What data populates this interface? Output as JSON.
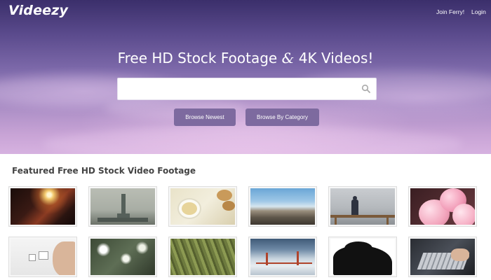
{
  "header": {
    "logo": "Videezy",
    "join_link": "Join Ferry!",
    "login_link": "Login"
  },
  "hero": {
    "headline_part1": "Free HD Stock Footage ",
    "headline_amp": "&",
    "headline_part2": " 4K Videos!",
    "search": {
      "value": "",
      "placeholder": ""
    },
    "buttons": {
      "browse_newest": "Browse Newest",
      "browse_category": "Browse By Category"
    }
  },
  "featured": {
    "title": "Featured Free HD Stock Video Footage",
    "rows": [
      [
        {
          "subject": "cave-light-beam"
        },
        {
          "subject": "statue-of-liberty"
        },
        {
          "subject": "tea-and-cookies"
        },
        {
          "subject": "rocky-beach"
        },
        {
          "subject": "person-at-railing"
        },
        {
          "subject": "pink-balloons"
        }
      ],
      [
        {
          "subject": "hand-with-dice"
        },
        {
          "subject": "blossom-branches"
        },
        {
          "subject": "green-plants"
        },
        {
          "subject": "golden-gate-fog"
        },
        {
          "subject": "tree-silhouette"
        },
        {
          "subject": "typing-on-laptop"
        }
      ]
    ]
  },
  "colors": {
    "hero_top": "#3b2f6b",
    "hero_bottom": "#d6b2e0",
    "button_bg": "#7d6a9f",
    "text_dark": "#444444"
  }
}
